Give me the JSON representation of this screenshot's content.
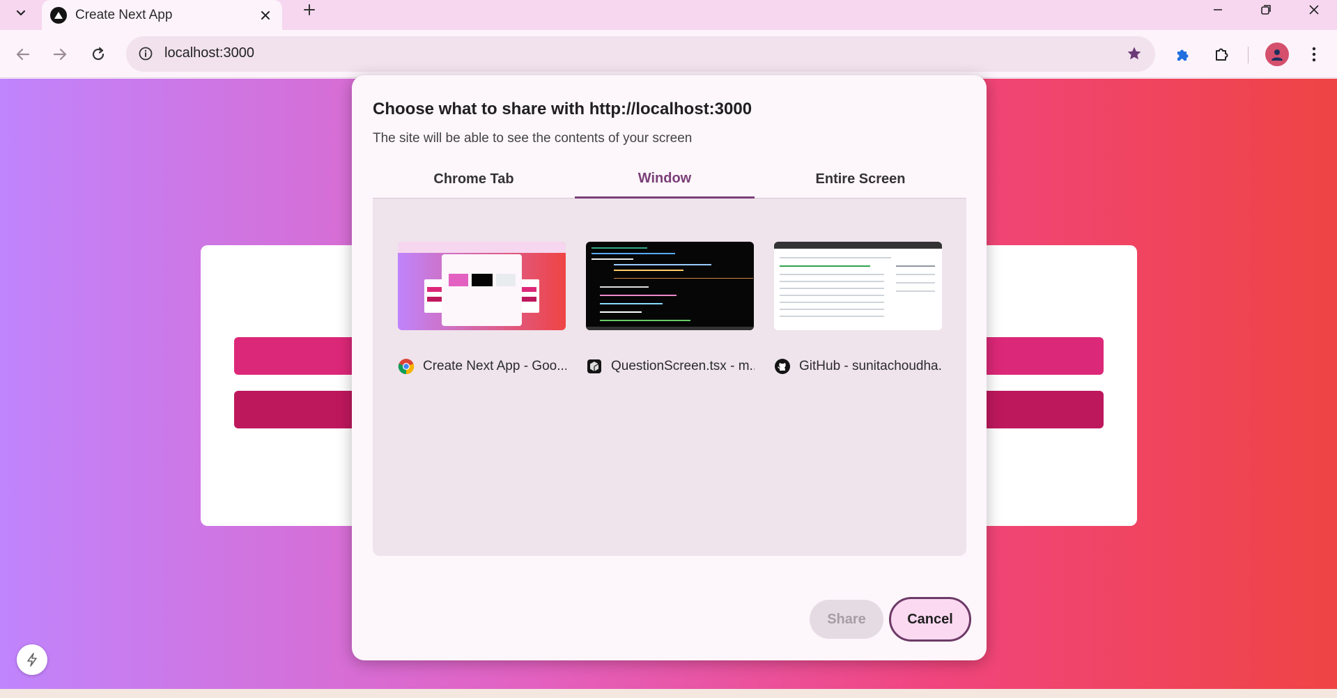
{
  "browser": {
    "tab_title": "Create Next App",
    "url": "localhost:3000"
  },
  "dialog": {
    "title": "Choose what to share with http://localhost:3000",
    "subtitle": "The site will be able to see the contents of your screen",
    "tabs": [
      {
        "label": "Chrome Tab",
        "active": false
      },
      {
        "label": "Window",
        "active": true
      },
      {
        "label": "Entire Screen",
        "active": false
      }
    ],
    "windows": [
      {
        "label": "Create Next App - Goo...",
        "icon": "chrome-icon"
      },
      {
        "label": "QuestionScreen.tsx - m...",
        "icon": "cursor-icon"
      },
      {
        "label": "GitHub - sunitachoudha...",
        "icon": "github-icon"
      }
    ],
    "share_label": "Share",
    "cancel_label": "Cancel"
  },
  "colors": {
    "accent": "#7a3f78",
    "cancel_bg": "#fbd9f1",
    "bar_primary": "#dc2878",
    "bar_secondary": "#be185d"
  }
}
